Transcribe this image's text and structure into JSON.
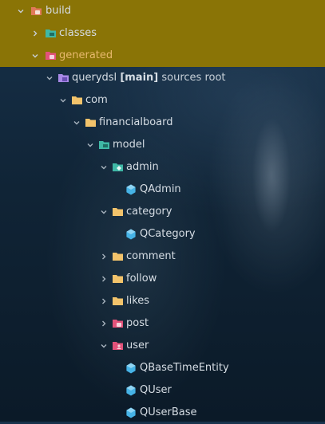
{
  "tree": {
    "build": {
      "label": "build",
      "icon": "folder-excluded-icon"
    },
    "classes": {
      "label": "classes",
      "icon": "folder-teal-icon"
    },
    "generated": {
      "label": "generated",
      "icon": "folder-generated-icon"
    },
    "querydsl": {
      "label": "querydsl",
      "branch": "[main]",
      "suffix": "sources root",
      "icon": "module-folder-icon"
    },
    "com": {
      "label": "com",
      "icon": "folder-icon"
    },
    "financialboard": {
      "label": "financialboard",
      "icon": "folder-icon"
    },
    "model": {
      "label": "model",
      "icon": "folder-teal-icon"
    },
    "admin": {
      "label": "admin",
      "icon": "folder-admin-icon"
    },
    "qadmin": {
      "label": "QAdmin",
      "icon": "class-icon"
    },
    "category": {
      "label": "category",
      "icon": "folder-icon"
    },
    "qcategory": {
      "label": "QCategory",
      "icon": "class-icon"
    },
    "comment": {
      "label": "comment",
      "icon": "folder-icon"
    },
    "follow": {
      "label": "follow",
      "icon": "folder-icon"
    },
    "likes": {
      "label": "likes",
      "icon": "folder-icon"
    },
    "post": {
      "label": "post",
      "icon": "folder-pink-icon"
    },
    "user": {
      "label": "user",
      "icon": "folder-user-icon"
    },
    "qbasetimeentity": {
      "label": "QBaseTimeEntity",
      "icon": "class-icon"
    },
    "quser": {
      "label": "QUser",
      "icon": "class-icon"
    },
    "quserbase": {
      "label": "QUserBase",
      "icon": "class-icon"
    }
  },
  "colors": {
    "selection": "#8a7406",
    "folder": "#f2c36b",
    "teal": "#3fb8a6",
    "pink": "#e2527a",
    "class": "#46b3e6",
    "module": "#a889e6"
  }
}
